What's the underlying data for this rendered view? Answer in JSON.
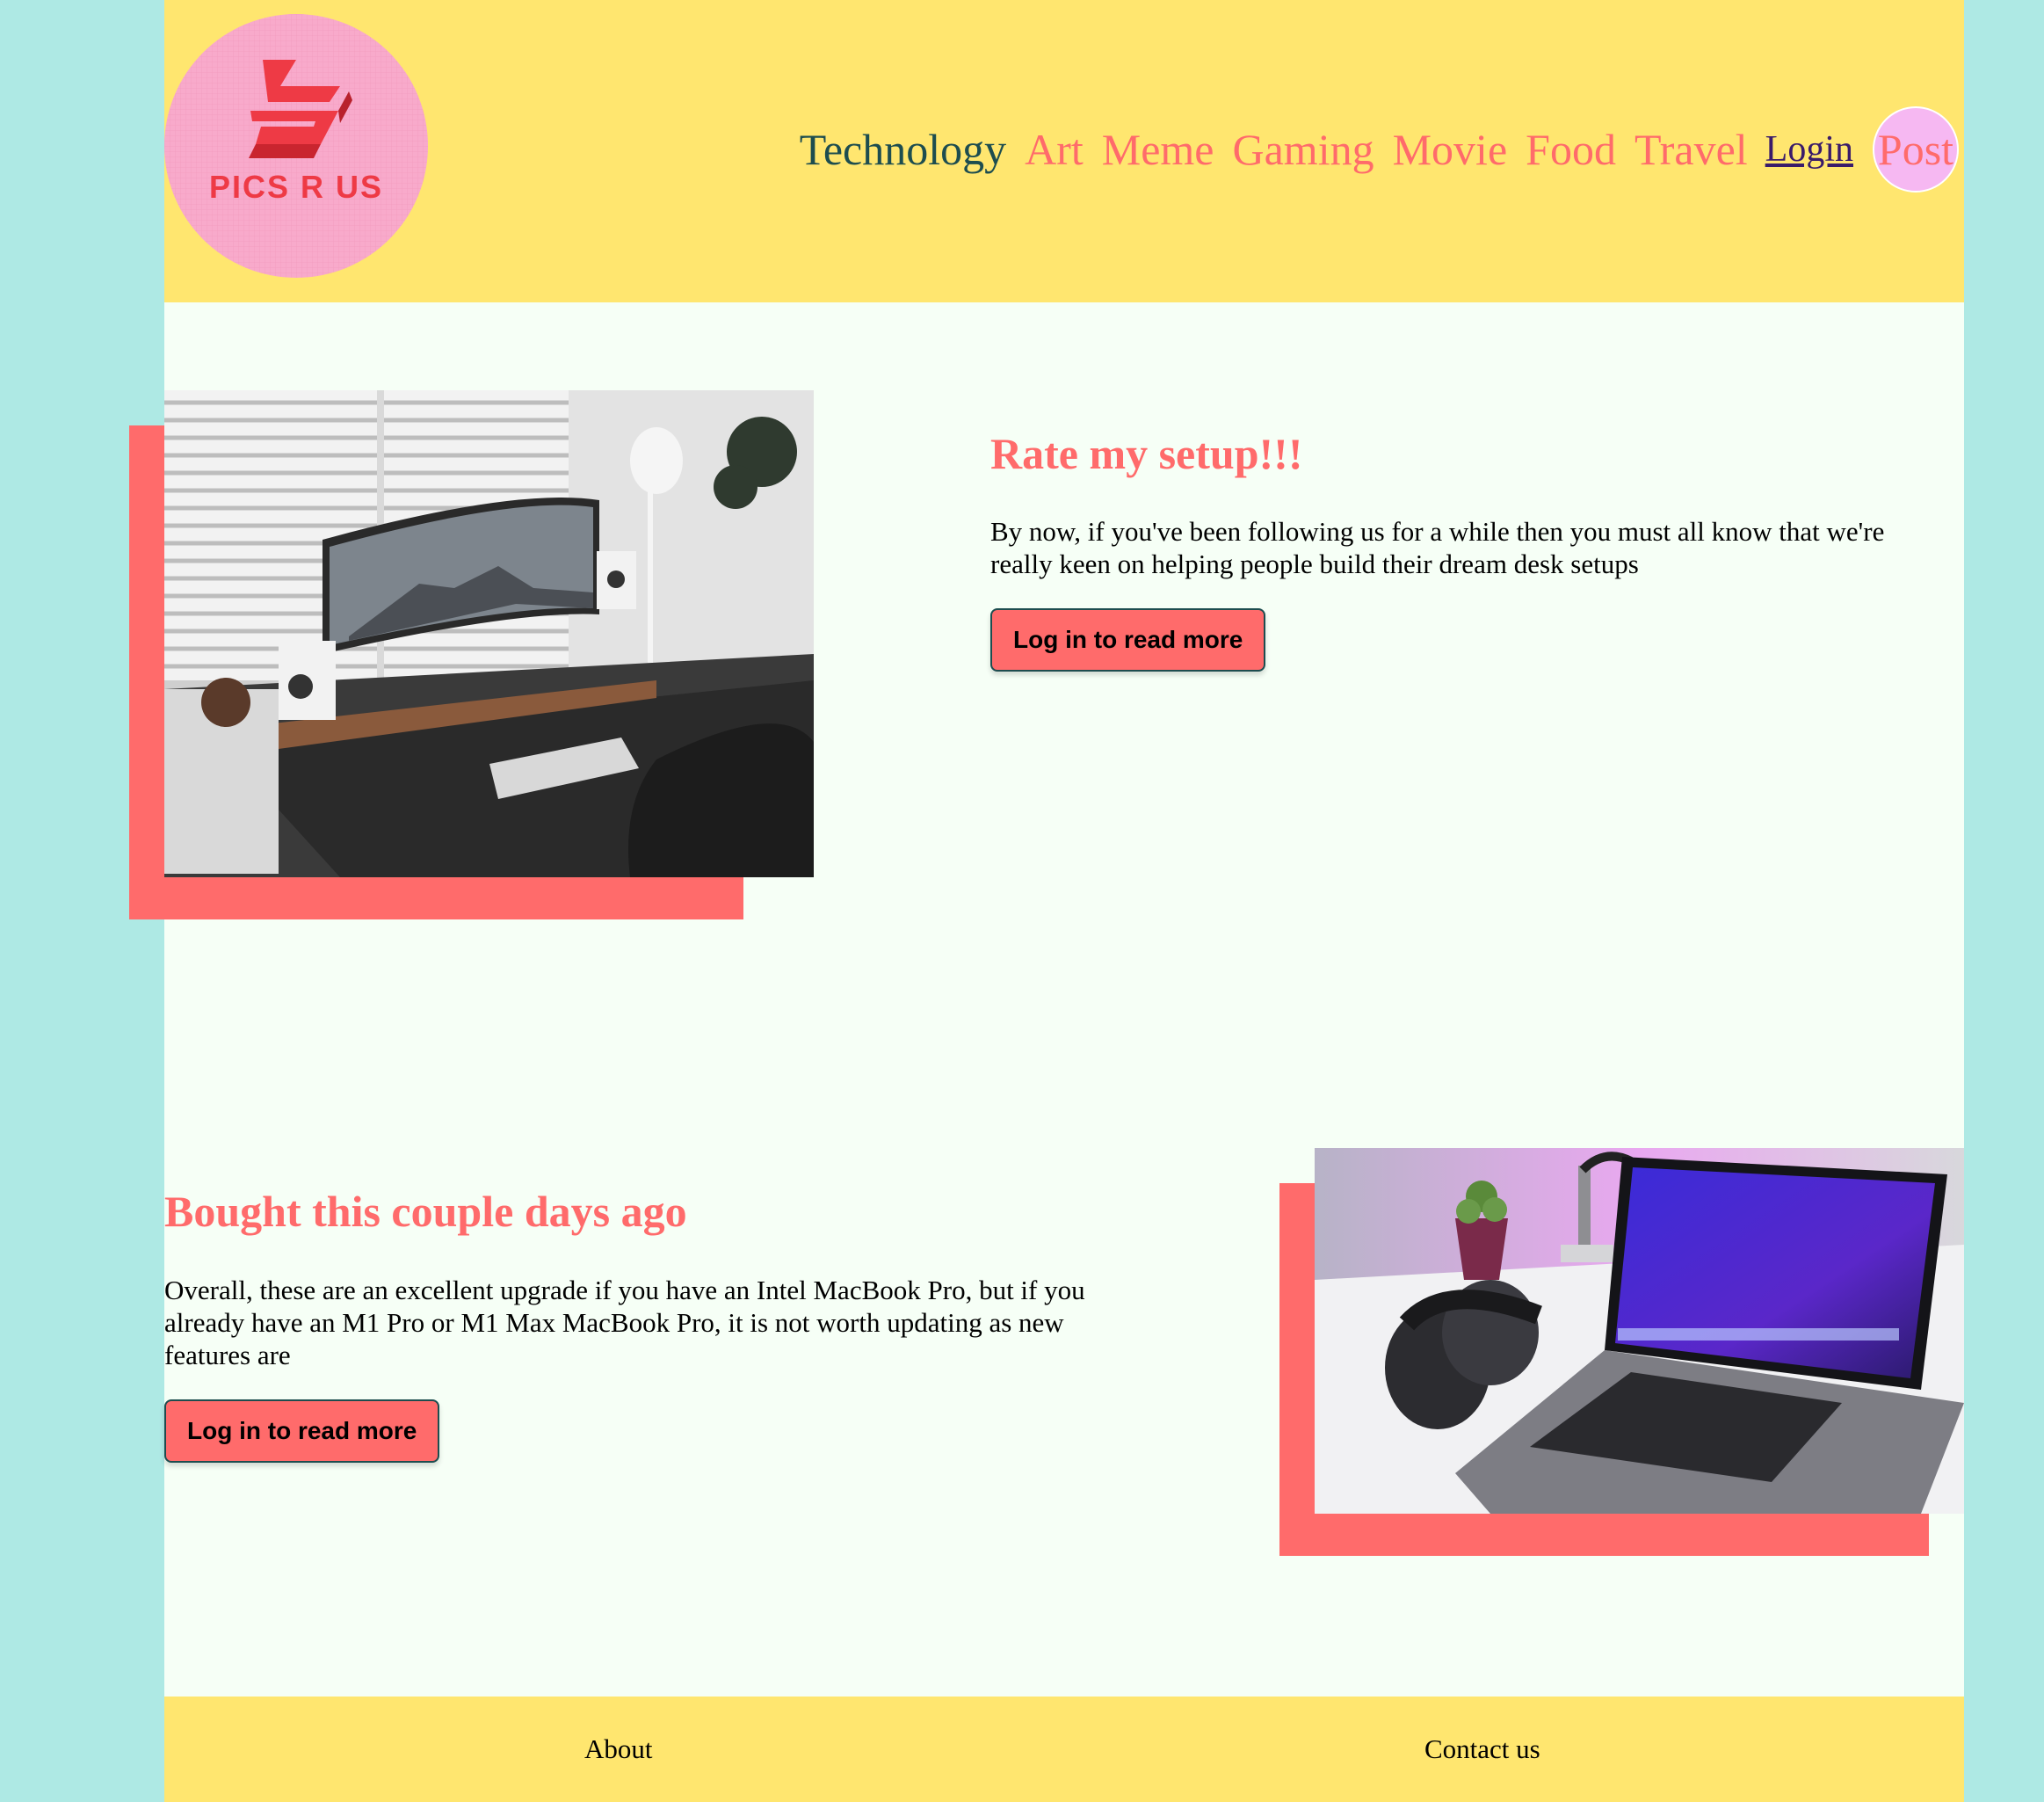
{
  "brand": {
    "logo_text": "PICS R US",
    "logo_bg": "#f8aacb",
    "logo_color": "#ee3a45"
  },
  "colors": {
    "background": "#aee9e4",
    "page": "#f6fff6",
    "header": "#ffe66f",
    "accent": "#ff6b6b",
    "active_nav": "#1d4d4f"
  },
  "nav": {
    "items": [
      {
        "label": "Technology",
        "active": true
      },
      {
        "label": "Art"
      },
      {
        "label": "Meme"
      },
      {
        "label": "Gaming"
      },
      {
        "label": "Movie"
      },
      {
        "label": "Food"
      },
      {
        "label": "Travel"
      }
    ],
    "login": "Login",
    "post": "Post"
  },
  "posts": [
    {
      "title": "Rate my setup!!!",
      "text": "By now, if you've been following us for a while then you must all know that we're really keen on helping people build their dream desk setups",
      "button": "Log in to read more",
      "image": "desk-setup-photo"
    },
    {
      "title": "Bought this couple days ago",
      "text": "Overall, these are an excellent upgrade if you have an Intel MacBook Pro, but if you already have an M1 Pro or M1 Max MacBook Pro, it is not worth updating as new features are",
      "button": "Log in to read more",
      "image": "macbook-airpods-photo"
    }
  ],
  "footer": {
    "about": "About",
    "contact": "Contact us"
  }
}
